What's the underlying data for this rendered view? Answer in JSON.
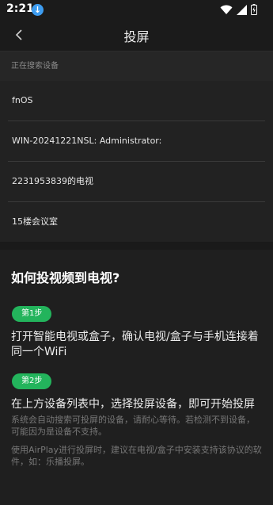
{
  "status_bar": {
    "time": "2:21",
    "download_icon": "download-arrow-icon"
  },
  "header": {
    "title": "投屏",
    "back_icon": "chevron-left-icon"
  },
  "devices": {
    "searching_label": "正在搜索设备",
    "items": [
      "fnOS",
      "WIN-20241221NSL: Administrator:",
      "2231953839的电视",
      "15楼会议室"
    ]
  },
  "help": {
    "title": "如何投视频到电视?",
    "step1_badge": "第1步",
    "step1_text": "打开智能电视或盒子，确认电视/盒子与手机连接着同一个WiFi",
    "step2_badge": "第2步",
    "step2_text": "在上方设备列表中，选择投屏设备，即可开始投屏",
    "note1": "系统会自动搜索可投屏的设备，请耐心等待。若检测不到设备，可能因为是设备不支持。",
    "note2": "使用AirPlay进行投屏时，建议在电视/盒子中安装支持该协议的软件，如：乐播投屏。"
  },
  "colors": {
    "accent_green": "#23b45c",
    "background": "#1e1e1e"
  }
}
